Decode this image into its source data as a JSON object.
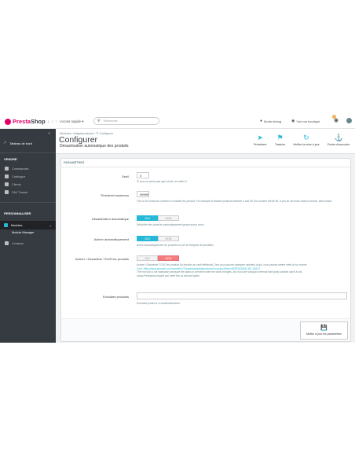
{
  "header": {
    "logo_part1": "Presta",
    "logo_part2": "Shop",
    "version": "1.7.7.1",
    "quick_access": "Accès rapide ▾",
    "search_placeholder": "Rechercher",
    "debug": "Mode debug",
    "view_shop": "Voir ma boutique",
    "notif_count": "2"
  },
  "sidebar": {
    "dashboard": "Tableau de bord",
    "sell_section": "Vendre",
    "sell_items": [
      "Commandes",
      "Catalogue",
      "Clients",
      "SAV Transb"
    ],
    "customize_section": "Personnaliser",
    "modules": "Modules",
    "module_manager": "Module Manager",
    "last_item": "Livraison"
  },
  "toolbar": {
    "breadcrumb": "Modules  /  widgetproducts  /  ✎ Configurer",
    "title": "Configurer",
    "subtitle": "Désactivation automatique des produits",
    "buttons": [
      {
        "label": "Précédent",
        "icon": "back-icon"
      },
      {
        "label": "Traduire",
        "icon": "flag-icon"
      },
      {
        "label": "Vérifier la mise à jour",
        "icon": "refresh-icon"
      },
      {
        "label": "Points d'accroche",
        "icon": "anchor-icon"
      }
    ]
  },
  "panel": {
    "heading": "Paramètres",
    "seuil": {
      "label": "Seuil",
      "value": "0",
      "help": "Si vous ne savez pas quoi choisir, la mettre 0."
    },
    "threshold_max": {
      "label": "Threshold maximum",
      "value": "99999",
      "help": "This is the maximum number to consider the product. For example to disable products between 0 and 99, this number will be 99. If you do not know what to choose, leave blank."
    },
    "auto_disable": {
      "label": "Désactivation automatique",
      "on": "OUI",
      "off": "NON",
      "help": "Désactive des produits automatiquement quand aucun stock."
    },
    "auto_enable": {
      "label": "Activer automatiquement",
      "on": "OUI",
      "off": "NON",
      "help": "Active automatiquement les produits lors de la réception de quantités."
    },
    "toggle_all": {
      "label": "Activer / Désactiver TOUS les produits",
      "on": "OUI",
      "off": "NON",
      "help_lines": [
        "Activer / Désactiver TOUS les produits (la fonction du seuil définisse) Ceux pour pouvoir quelques minutes) Aussi, vous pouvez mettre cette url un cronne",
        "Cron: https://www.yoursite.com/modules/77/modulesdisableproducts/cron.php?token=89EFD0D5A2-BC-36A23",
        "The cron job is not mandatory because the status is checked when the stock changes, but if you are using an external third party solution and it is not",
        "using Prestashop maybe you need this as second option"
      ]
    },
    "excluded": {
      "label": "Excluded products",
      "help": "Excluded products in enabled/disabled"
    },
    "save_label": "Mettre à jour les paramètres"
  }
}
